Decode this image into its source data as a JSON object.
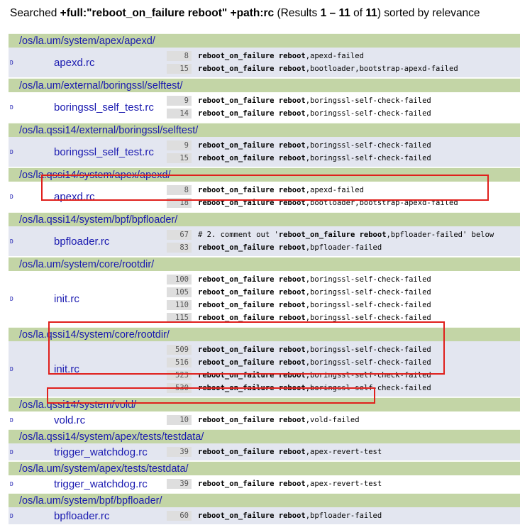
{
  "header": {
    "prefix": "Searched ",
    "query": "+full:\"reboot_on_failure reboot\" +path:rc",
    "results_open": " (Results ",
    "range": "1 – 11",
    "of": " of ",
    "total": "11",
    "close": ") sorted by relevance"
  },
  "colors": {
    "dir_bg": "#c3d5a6",
    "alt_row": "#e3e6f0",
    "link": "#1a1ab0",
    "highlight": "#e0201c"
  },
  "results": [
    {
      "dir": "/os/la.um/system/apex/apexd/",
      "file": "apexd.rc",
      "marker": "D",
      "shade": "alt",
      "lines": [
        {
          "num": "8",
          "bold": "reboot_on_failure reboot",
          "rest": ",apexd-failed"
        },
        {
          "num": "15",
          "bold": "reboot_on_failure reboot",
          "rest": ",bootloader,bootstrap-apexd-failed"
        }
      ]
    },
    {
      "dir": "/os/la.um/external/boringssl/selftest/",
      "file": "boringssl_self_test.rc",
      "marker": "D",
      "shade": "plain",
      "lines": [
        {
          "num": "9",
          "bold": "reboot_on_failure reboot",
          "rest": ",boringssl-self-check-failed"
        },
        {
          "num": "14",
          "bold": "reboot_on_failure reboot",
          "rest": ",boringssl-self-check-failed"
        }
      ]
    },
    {
      "dir": "/os/la.qssi14/external/boringssl/selftest/",
      "file": "boringssl_self_test.rc",
      "marker": "D",
      "shade": "alt",
      "lines": [
        {
          "num": "9",
          "bold": "reboot_on_failure reboot",
          "rest": ",boringssl-self-check-failed"
        },
        {
          "num": "15",
          "bold": "reboot_on_failure reboot",
          "rest": ",boringssl-self-check-failed"
        }
      ]
    },
    {
      "dir": "/os/la.qssi14/system/apex/apexd/",
      "file": "apexd.rc",
      "marker": "D",
      "shade": "plain",
      "lines": [
        {
          "num": "8",
          "bold": "reboot_on_failure reboot",
          "rest": ",apexd-failed"
        },
        {
          "num": "18",
          "bold": "reboot_on_failure reboot",
          "rest": ",bootloader,bootstrap-apexd-failed"
        }
      ]
    },
    {
      "dir": "/os/la.qssi14/system/bpf/bpfloader/",
      "file": "bpfloader.rc",
      "marker": "D",
      "shade": "alt",
      "lines": [
        {
          "num": "67",
          "pre": "# 2. comment out '",
          "bold": "reboot_on_failure reboot",
          "rest": ",bpfloader-failed' below"
        },
        {
          "num": "83",
          "bold": "reboot_on_failure reboot",
          "rest": ",bpfloader-failed"
        }
      ]
    },
    {
      "dir": "/os/la.um/system/core/rootdir/",
      "file": "init.rc",
      "marker": "D",
      "shade": "plain",
      "lines": [
        {
          "num": "100",
          "bold": "reboot_on_failure reboot",
          "rest": ",boringssl-self-check-failed"
        },
        {
          "num": "105",
          "bold": "reboot_on_failure reboot",
          "rest": ",boringssl-self-check-failed"
        },
        {
          "num": "110",
          "bold": "reboot_on_failure reboot",
          "rest": ",boringssl-self-check-failed"
        },
        {
          "num": "115",
          "bold": "reboot_on_failure reboot",
          "rest": ",boringssl-self-check-failed"
        }
      ]
    },
    {
      "dir": "/os/la.qssi14/system/core/rootdir/",
      "file": "init.rc",
      "marker": "D",
      "shade": "alt",
      "lines": [
        {
          "num": "509",
          "bold": "reboot_on_failure reboot",
          "rest": ",boringssl-self-check-failed"
        },
        {
          "num": "516",
          "bold": "reboot_on_failure reboot",
          "rest": ",boringssl-self-check-failed"
        },
        {
          "num": "523",
          "bold": "reboot_on_failure reboot",
          "rest": ",boringssl-self-check-failed"
        },
        {
          "num": "530",
          "bold": "reboot_on_failure reboot",
          "rest": ",boringssl-self-check-failed"
        }
      ]
    },
    {
      "dir": "/os/la.qssi14/system/vold/",
      "file": "vold.rc",
      "marker": "D",
      "shade": "plain",
      "lines": [
        {
          "num": "10",
          "bold": "reboot_on_failure reboot",
          "rest": ",vold-failed"
        }
      ]
    },
    {
      "dir": "/os/la.qssi14/system/apex/tests/testdata/",
      "file": "trigger_watchdog.rc",
      "marker": "D",
      "shade": "alt",
      "lines": [
        {
          "num": "39",
          "bold": "reboot_on_failure reboot",
          "rest": ",apex-revert-test"
        }
      ]
    },
    {
      "dir": "/os/la.um/system/apex/tests/testdata/",
      "file": "trigger_watchdog.rc",
      "marker": "D",
      "shade": "plain",
      "lines": [
        {
          "num": "39",
          "bold": "reboot_on_failure reboot",
          "rest": ",apex-revert-test"
        }
      ]
    },
    {
      "dir": "/os/la.um/system/bpf/bpfloader/",
      "file": "bpfloader.rc",
      "marker": "D",
      "shade": "alt",
      "lines": [
        {
          "num": "60",
          "bold": "reboot_on_failure reboot",
          "rest": ",bpfloader-failed"
        }
      ]
    }
  ]
}
